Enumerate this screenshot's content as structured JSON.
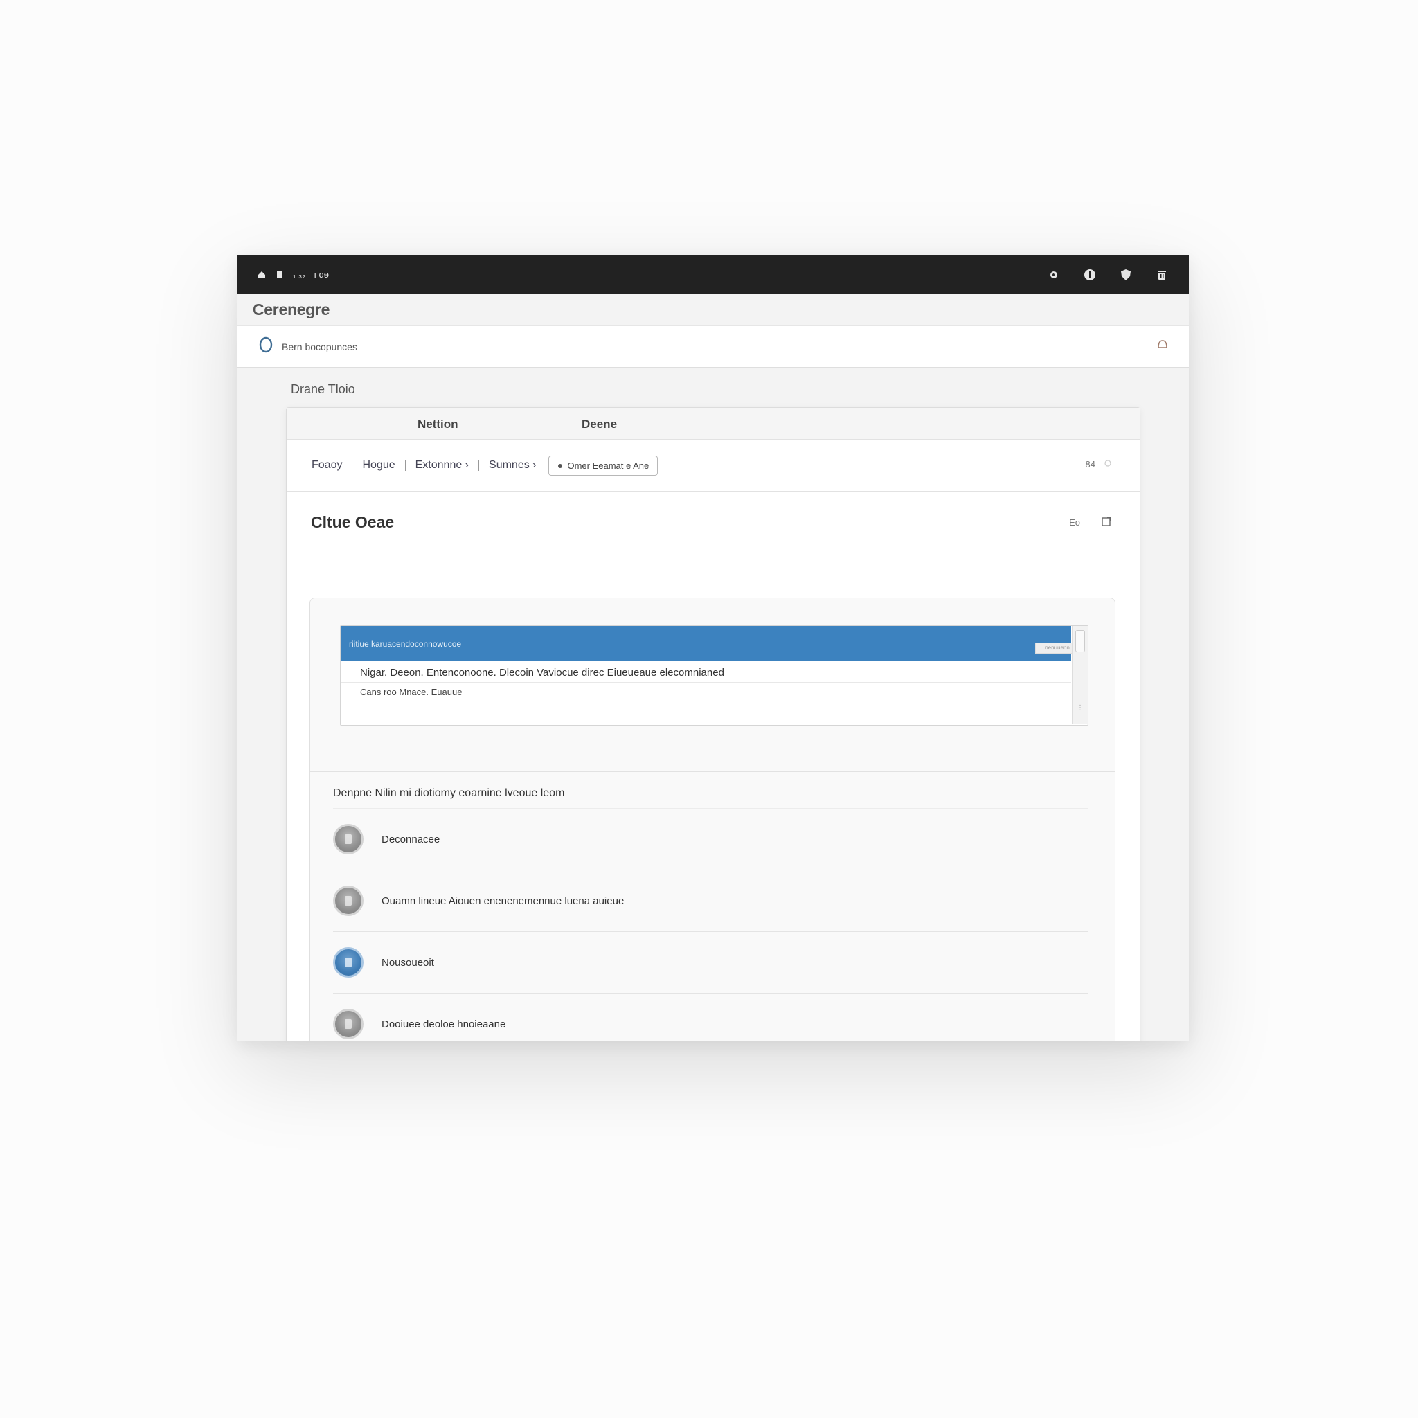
{
  "titlebar": {
    "left_text_1": "₁ ₃₂",
    "left_text_2": "ı ɑɘ",
    "icons": [
      "settings-icon",
      "info-icon",
      "shield-icon",
      "trash-icon"
    ]
  },
  "app": {
    "title": "Cerenegre"
  },
  "search": {
    "value": "Bern bocopunces"
  },
  "section_label": "Drane Tloio",
  "panel": {
    "columns": [
      "Nettion",
      "Deene"
    ],
    "filters": [
      {
        "label": "Foaoy",
        "has_sep": true
      },
      {
        "label": "Hogue",
        "has_sep": true
      },
      {
        "label": "Extonnne ›",
        "has_sep": true
      },
      {
        "label": "Sumnes ›",
        "has_sep": false
      }
    ],
    "chip_label": "Omer  Eeamat e Ane",
    "filter_right": "84",
    "content_title": "Cltue  Oeae",
    "content_action": "Eo"
  },
  "dropdown": {
    "selected": "riitiue karuacendoconnowucoe",
    "options": [
      "Nigar. Deeon. Entenconoone.  Dlecoin Vaviocue direc Eiueueaue elecomnianed",
      "Cans roo Mnace. Euauue"
    ],
    "tag": "nenuuenn"
  },
  "list": {
    "heading": "Denpne Nilin mi diotiomy eoarnine lveoue leom",
    "items": [
      {
        "label": "Deconnacee",
        "color": "#8e8e8e"
      },
      {
        "label": "Ouamn lineue Aiouen enenenemennue luena auieue",
        "color": "#8e8e8e"
      },
      {
        "label": "Nousoueoit",
        "color": "#3f7cb5"
      },
      {
        "label": "Dooiuee deoloe hnoieaane",
        "color": "#8e8e8e"
      },
      {
        "label": "",
        "color": "#8e8e8e"
      }
    ]
  },
  "colors": {
    "titlebar_bg": "#222222",
    "accent_blue": "#3c82bf"
  }
}
